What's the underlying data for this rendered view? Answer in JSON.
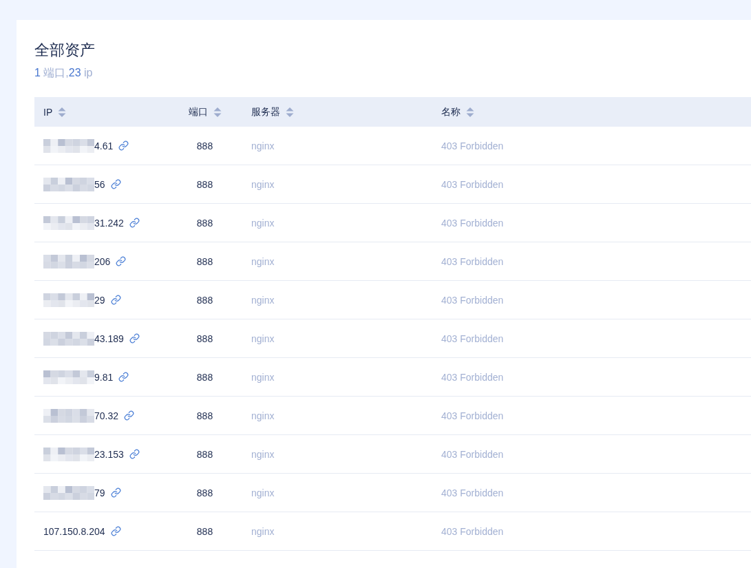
{
  "page": {
    "title": "全部资产",
    "summary": {
      "port_count": "1",
      "port_label": "端口,",
      "ip_count": "23",
      "ip_label": "ip"
    }
  },
  "table": {
    "columns": [
      {
        "label": "IP",
        "kind": "ip",
        "sortable": true
      },
      {
        "label": "端口",
        "kind": "port",
        "sortable": true
      },
      {
        "label": "服务器",
        "kind": "server",
        "sortable": true
      },
      {
        "label": "名称",
        "kind": "name",
        "sortable": true
      }
    ],
    "rows": [
      {
        "ip": "4.61",
        "redacted": true,
        "port": "888",
        "server": "nginx",
        "name": "403 Forbidden"
      },
      {
        "ip": "56",
        "redacted": true,
        "port": "888",
        "server": "nginx",
        "name": "403 Forbidden"
      },
      {
        "ip": "31.242",
        "redacted": true,
        "port": "888",
        "server": "nginx",
        "name": "403 Forbidden"
      },
      {
        "ip": "206",
        "redacted": true,
        "port": "888",
        "server": "nginx",
        "name": "403 Forbidden"
      },
      {
        "ip": "29",
        "redacted": true,
        "port": "888",
        "server": "nginx",
        "name": "403 Forbidden"
      },
      {
        "ip": "43.189",
        "redacted": true,
        "port": "888",
        "server": "nginx",
        "name": "403 Forbidden"
      },
      {
        "ip": "9.81",
        "redacted": true,
        "port": "888",
        "server": "nginx",
        "name": "403 Forbidden"
      },
      {
        "ip": "70.32",
        "redacted": true,
        "port": "888",
        "server": "nginx",
        "name": "403 Forbidden"
      },
      {
        "ip": "23.153",
        "redacted": true,
        "port": "888",
        "server": "nginx",
        "name": "403 Forbidden"
      },
      {
        "ip": "79",
        "redacted": true,
        "port": "888",
        "server": "nginx",
        "name": "403 Forbidden"
      },
      {
        "ip": "107.150.8.204",
        "redacted": false,
        "port": "888",
        "server": "nginx",
        "name": "403 Forbidden"
      }
    ]
  }
}
